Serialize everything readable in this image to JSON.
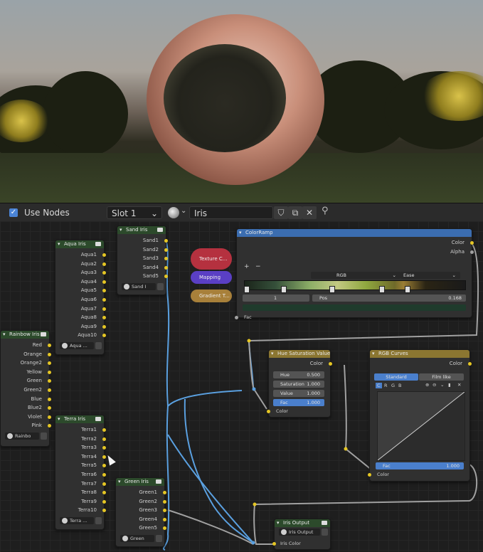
{
  "header": {
    "use_nodes_label": "Use Nodes",
    "slot": "Slot 1",
    "material_name": "Iris"
  },
  "nodes": {
    "aqua": {
      "title": "Aqua Iris",
      "outputs": [
        "Aqua1",
        "Aqua2",
        "Aqua3",
        "Aqua4",
        "Aqua5",
        "Aqua6",
        "Aqua7",
        "Aqua8",
        "Aqua9",
        "Aqua10"
      ],
      "footer": "Aqua ..."
    },
    "sand": {
      "title": "Sand Iris",
      "outputs": [
        "Sand1",
        "Sand2",
        "Sand3",
        "Sand4",
        "Sand5"
      ],
      "footer": "Sand I"
    },
    "rainbow": {
      "title": "Rainbow Iris",
      "outputs": [
        "Red",
        "Orange",
        "Orange2",
        "Yellow",
        "Green",
        "Green2",
        "Blue",
        "Blue2",
        "Violet",
        "Pink"
      ],
      "footer": "Rainbo"
    },
    "terra": {
      "title": "Terra Iris",
      "outputs": [
        "Terra1",
        "Terra2",
        "Terra3",
        "Terra4",
        "Terra5",
        "Terra6",
        "Terra7",
        "Terra8",
        "Terra9",
        "Terra10"
      ],
      "footer": "Terra ..."
    },
    "greeniris": {
      "title": "Green Iris",
      "outputs": [
        "Green1",
        "Green2",
        "Green3",
        "Green4",
        "Green5"
      ],
      "footer": "Green"
    },
    "colorramp": {
      "title": "ColorRamp",
      "out_color": "Color",
      "out_alpha": "Alpha",
      "plus": "+",
      "minus": "−",
      "mode": "RGB",
      "interp": "Ease",
      "index": "1",
      "pos_label": "Pos",
      "pos_value": "0.168",
      "fac": "Fac"
    },
    "texture": {
      "label": "Texture C..."
    },
    "mapping": {
      "label": "Mapping"
    },
    "gradient": {
      "label": "Gradient T..."
    },
    "huesat": {
      "title": "Hue Saturation Value",
      "out_color": "Color",
      "hue_label": "Hue",
      "hue": "0.500",
      "sat_label": "Saturation",
      "sat": "1.000",
      "val_label": "Value",
      "val": "1.000",
      "fac_label": "Fac",
      "fac": "1.000",
      "in_color": "Color"
    },
    "rgbcurves": {
      "title": "RGB Curves",
      "out_color": "Color",
      "tab_standard": "Standard",
      "tab_filmlike": "Film like",
      "channels": [
        "C",
        "R",
        "G",
        "B"
      ],
      "fac_label": "Fac",
      "fac": "1.000",
      "in_color": "Color"
    },
    "output": {
      "title": "Iris Output",
      "footer": "Iris Output",
      "in_color": "Iris Color"
    }
  }
}
